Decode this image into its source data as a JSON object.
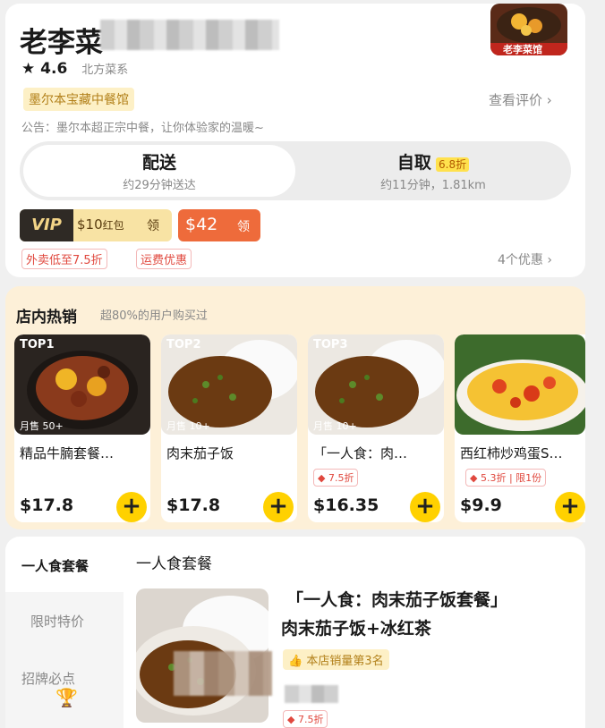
{
  "shop": {
    "name": "老李菜",
    "rating": "4.6",
    "cuisine": "北方菜系",
    "badge": "墨尔本宝藏中餐馆",
    "review_link": "查看评价",
    "notice": "公告：墨尔本超正宗中餐，让你体验家的温暖~",
    "logo_caption": "老李菜馆"
  },
  "delivery": {
    "deliver_label": "配送",
    "deliver_time": "约29分钟送达",
    "pickup_label": "自取",
    "pickup_discount": "6.8折",
    "pickup_info": "约11分钟，1.81km"
  },
  "coupons": {
    "vip_label": "VIP",
    "vip_amount": "$10",
    "vip_unit": "红包",
    "claim1": "领",
    "coupon_amount": "$42",
    "claim2": "领",
    "promo1": "外卖低至7.5折",
    "promo2": "运费优惠",
    "offers_link": "4个优惠"
  },
  "hot": {
    "title": "店内热销",
    "subtitle": "超80%的用户购买过",
    "items": [
      {
        "rank": "TOP1",
        "sales": "月售 50+",
        "name": "精品牛腩套餐…",
        "tag": "",
        "price": "$17.8"
      },
      {
        "rank": "TOP2",
        "sales": "月售 10+",
        "name": "肉末茄子饭",
        "tag": "",
        "price": "$17.8"
      },
      {
        "rank": "TOP3",
        "sales": "月售 10+",
        "name": "「一人食：肉…",
        "tag": "7.5折",
        "price": "$16.35"
      },
      {
        "rank": "",
        "sales": "",
        "name": "西红柿炒鸡蛋S…",
        "tag": "5.3折 | 限1份",
        "price": "$9.9"
      }
    ]
  },
  "menu": {
    "categories": [
      "一人食套餐",
      "限时特价",
      "招牌必点"
    ],
    "section_title": "一人食套餐",
    "item_name_line1": "「一人食：肉末茄子饭套餐」",
    "item_name_line2": "肉末茄子饭+冰红茶",
    "item_rank": "本店销量第3名",
    "item_discount": "7.5折"
  },
  "icons": [
    "star-icon",
    "chevron-right-icon",
    "plus-icon",
    "tag-icon",
    "trophy-icon",
    "thumb-icon"
  ],
  "colors": {
    "accent": "#ffd100",
    "red": "#e0483e",
    "orange": "#ee6b3b",
    "hot_bg": "#fdf0d8"
  }
}
